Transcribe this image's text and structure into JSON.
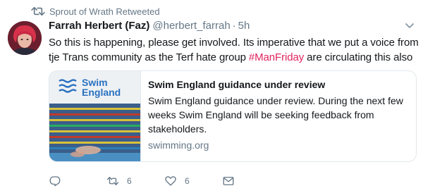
{
  "social_context": {
    "text": "Sprout of Wrath Retweeted",
    "icon": "retweet-icon"
  },
  "tweet": {
    "author_name": "Farrah Herbert (Faz)",
    "handle": "@herbert_farrah",
    "separator": "·",
    "time": "5h",
    "text_before": "So this is happening, please get involved. Its imperative that we put a voice from tje Trans community as the Terf hate group ",
    "hashtag": "#ManFriday",
    "text_after": " are circulating this also"
  },
  "card": {
    "image_brand_line1": "Swim",
    "image_brand_line2": "England",
    "title": "Swim England guidance under review",
    "description": "Swim England guidance under review. During the next few weeks Swim England will be seeking feedback from stakeholders.",
    "domain": "swimming.org"
  },
  "actions": {
    "reply_icon": "reply-icon",
    "retweet_count": "6",
    "like_count": "6",
    "dm_icon": "envelope-icon"
  },
  "colors": {
    "hashtag": "#e0245e",
    "secondary_text": "#657786",
    "border": "#e1e8ed"
  }
}
